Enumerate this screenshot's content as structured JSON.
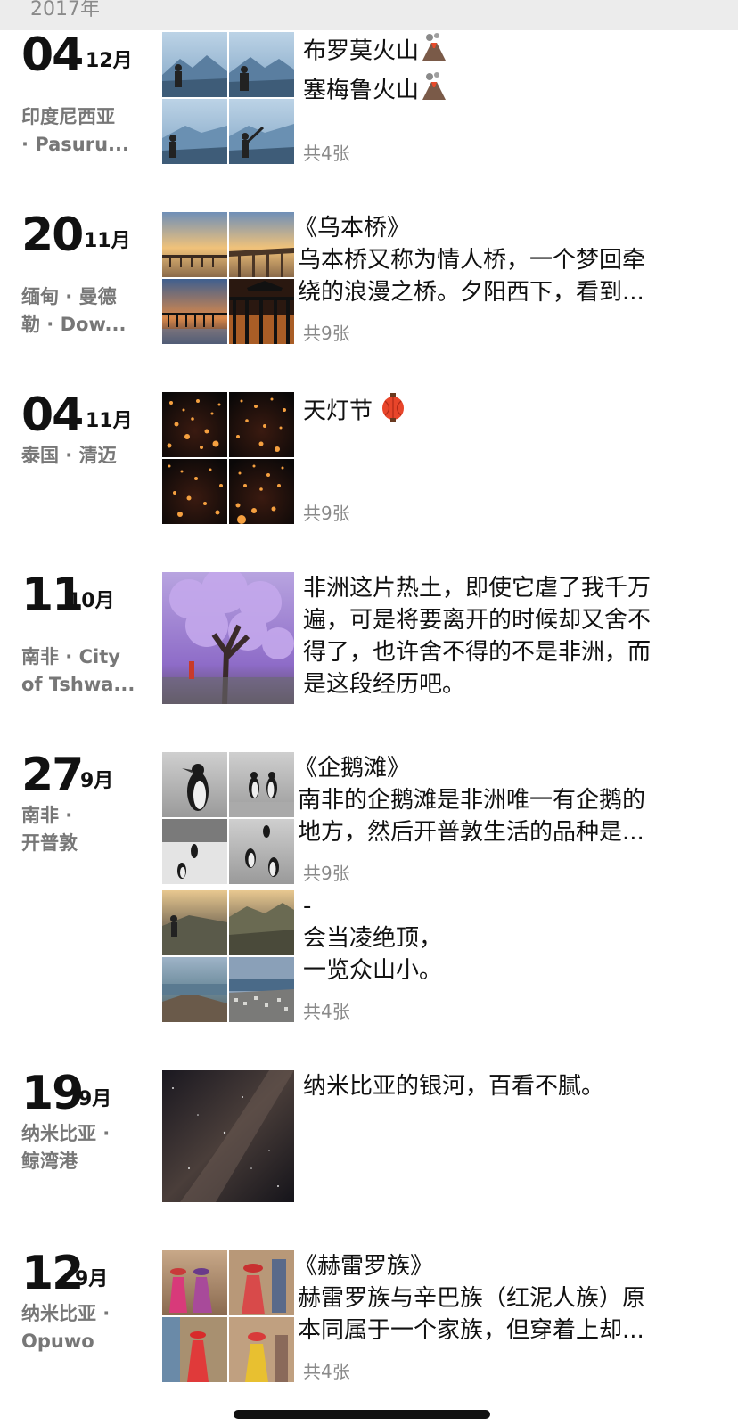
{
  "header": {
    "year": "2017年"
  },
  "entries": [
    {
      "day": "04",
      "month": "12月",
      "location": [
        "印度尼西亚",
        "· Pasuru..."
      ],
      "lines": [
        "布罗莫火山",
        "塞梅鲁火山"
      ],
      "count": "共4张",
      "photos": [
        "volcano-sitting-photo",
        "volcano-sitting-photo",
        "volcano-sitting-photo",
        "volcano-arm-raised-photo"
      ]
    },
    {
      "day": "20",
      "month": "11月",
      "location": [
        "缅甸 · 曼德",
        "勒 · Dow..."
      ],
      "lines": [
        "《乌本桥》",
        "乌本桥又称为情人桥，一个梦回牵",
        "绕的浪漫之桥。夕阳西下，看到..."
      ],
      "count": "共9张",
      "photos": [
        "sunset-bridge-photo",
        "bridge-photo",
        "bridge-silhouette-photo",
        "bridge-silhouette-photo"
      ]
    },
    {
      "day": "04",
      "month": "11月",
      "location": [
        "泰国 · 清迈"
      ],
      "lines": [
        "天灯节"
      ],
      "count": "共9张",
      "photos": [
        "lanterns-photo",
        "lanterns-photo",
        "lanterns-photo",
        "lanterns-photo"
      ]
    },
    {
      "day": "11",
      "month": "10月",
      "location": [
        "南非 · City",
        "of Tshwa..."
      ],
      "lines": [
        "非洲这片热土，即使它虐了我千万",
        "遍，可是将要离开的时候却又舍不",
        "得了，也许舍不得的不是非洲，而",
        "是这段经历吧。"
      ],
      "count": "",
      "photos": [
        "jacaranda-tree-photo"
      ]
    },
    {
      "day": "27",
      "month": "9月",
      "location": [
        "南非 ·",
        "开普敦"
      ],
      "lines": [
        "《企鹅滩》",
        "南非的企鹅滩是非洲唯一有企鹅的",
        "地方，然后开普敦生活的品种是..."
      ],
      "count": "共9张",
      "photos": [
        "penguin-photo",
        "penguin-photo",
        "penguin-photo",
        "penguin-photo"
      ],
      "lines2": [
        "-",
        "会当凌绝顶，",
        "一览众山小。"
      ],
      "count2": "共4张",
      "photos2": [
        "mountain-view-photo",
        "mountain-view-photo",
        "coastline-photo",
        "city-view-photo"
      ]
    },
    {
      "day": "19",
      "month": "9月",
      "location": [
        "纳米比亚 ·",
        "鲸湾港"
      ],
      "lines": [
        "纳米比亚的银河，百看不腻。"
      ],
      "count": "",
      "photos": [
        "milky-way-photo"
      ]
    },
    {
      "day": "12",
      "month": "9月",
      "location": [
        "纳米比亚 ·",
        "Opuwo"
      ],
      "lines": [
        "《赫雷罗族》",
        "赫雷罗族与辛巴族（红泥人族）原",
        "本同属于一个家族，但穿着上却..."
      ],
      "count": "共4张",
      "photos": [
        "herero-women-photo",
        "herero-women-photo",
        "herero-women-photo",
        "herero-women-photo"
      ]
    }
  ],
  "icons": {
    "volcano": "volcano-icon",
    "lantern": "lantern-icon"
  }
}
